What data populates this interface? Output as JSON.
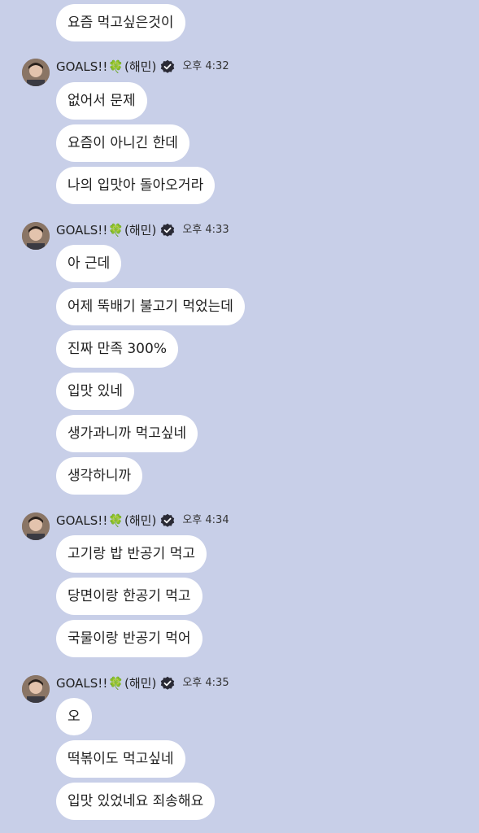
{
  "messages_before": [
    {
      "text": "요즘 먹고싶은것이"
    }
  ],
  "groups": [
    {
      "sender_name": "GOALS!!",
      "sender_suffix": "(해민)",
      "clover": "🍀",
      "time": "오후 4:32",
      "messages": [
        "없어서 문제",
        "요즘이 아니긴 한데",
        "나의 입맛아 돌아오거라"
      ]
    },
    {
      "sender_name": "GOALS!!",
      "sender_suffix": "(해민)",
      "clover": "🍀",
      "time": "오후 4:33",
      "messages": [
        "아 근데",
        "어제 뚝배기 불고기 먹었는데",
        "진짜 만족 300%",
        "입맛 있네",
        "생가과니까 먹고싶네",
        "생각하니까"
      ]
    },
    {
      "sender_name": "GOALS!!",
      "sender_suffix": "(해민)",
      "clover": "🍀",
      "time": "오후 4:34",
      "messages": [
        "고기랑 밥 반공기 먹고",
        "당면이랑 한공기 먹고",
        "국물이랑 반공기 먹어"
      ]
    },
    {
      "sender_name": "GOALS!!",
      "sender_suffix": "(해민)",
      "clover": "🍀",
      "time": "오후 4:35",
      "messages": [
        "오",
        "떡볶이도 먹고싶네",
        "입맛 있었네요 죄송해요"
      ]
    }
  ],
  "icons": {
    "avatar": "avatar-photo",
    "verified": "verified-badge-icon",
    "clover": "four-leaf-clover-icon"
  },
  "colors": {
    "background": "#c8cfe8",
    "bubble": "#ffffff",
    "text": "#1f1f1f"
  }
}
